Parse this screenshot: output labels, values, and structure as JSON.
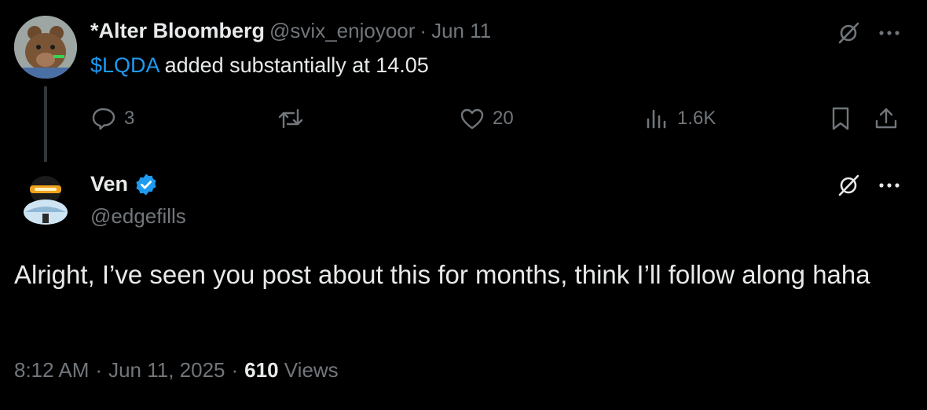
{
  "parent_tweet": {
    "display_name": "*Alter Bloomberg",
    "handle": "@svix_enjoyoor",
    "separator": "·",
    "date": "Jun 11",
    "cashtag": "$LQDA",
    "text": " added substantially at 14.05",
    "metrics": {
      "replies": "3",
      "reposts": "",
      "likes": "20",
      "views": "1.6K"
    }
  },
  "reply_tweet": {
    "display_name": "Ven",
    "handle": "@edgefills",
    "text": "Alright, I’ve seen you post about this for months, think I’ll follow along haha",
    "time": "8:12 AM",
    "separator1": "·",
    "date": "Jun 11, 2025",
    "separator2": "·",
    "views_count": "610",
    "views_label": "Views"
  },
  "colors": {
    "background": "#000000",
    "text": "#e7e9ea",
    "muted": "#71767b",
    "accent": "#1d9bf0"
  },
  "icons": [
    "grok-icon",
    "more-icon",
    "reply-icon",
    "repost-icon",
    "like-icon",
    "views-icon",
    "bookmark-icon",
    "share-icon",
    "verified-badge-icon"
  ]
}
